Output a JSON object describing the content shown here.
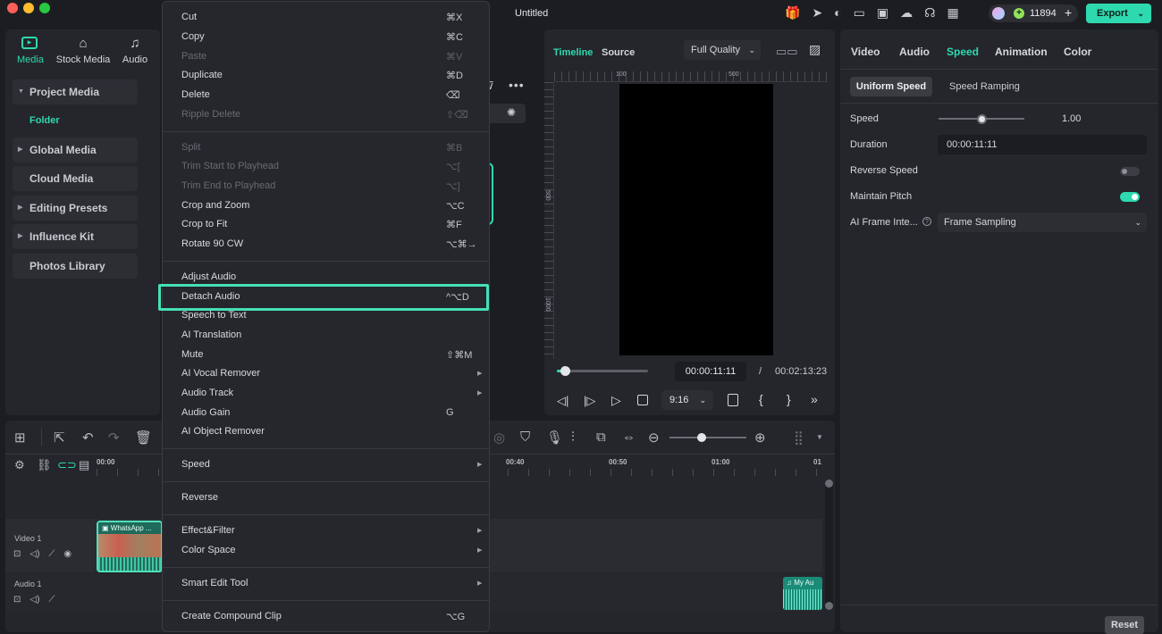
{
  "window": {
    "title": "Untitled",
    "credits": "11894",
    "export_label": "Export"
  },
  "media_tabs": [
    {
      "label": "Media"
    },
    {
      "label": "Stock Media"
    },
    {
      "label": "Audio"
    }
  ],
  "sidebar": {
    "items": [
      {
        "label": "Project Media"
      },
      {
        "label": "Folder"
      },
      {
        "label": "Global Media"
      },
      {
        "label": "Cloud Media"
      },
      {
        "label": "Editing Presets"
      },
      {
        "label": "Influence Kit"
      },
      {
        "label": "Photos Library"
      }
    ]
  },
  "context_menu": {
    "items": [
      {
        "label": "Cut",
        "shortcut": "⌘X"
      },
      {
        "label": "Copy",
        "shortcut": "⌘C"
      },
      {
        "label": "Paste",
        "shortcut": "⌘V"
      },
      {
        "label": "Duplicate",
        "shortcut": "⌘D"
      },
      {
        "label": "Delete",
        "shortcut": "⌫"
      },
      {
        "label": "Ripple Delete",
        "shortcut": "⇧⌫"
      },
      {
        "label": "Split",
        "shortcut": "⌘B"
      },
      {
        "label": "Trim Start to Playhead",
        "shortcut": "⌥["
      },
      {
        "label": "Trim End to Playhead",
        "shortcut": "⌥]"
      },
      {
        "label": "Crop and Zoom",
        "shortcut": "⌥C"
      },
      {
        "label": "Crop to Fit",
        "shortcut": "⌘F"
      },
      {
        "label": "Rotate 90 CW",
        "shortcut": "⌥⌘→"
      },
      {
        "label": "Adjust Audio",
        "shortcut": ""
      },
      {
        "label": "Detach Audio",
        "shortcut": "^⌥D"
      },
      {
        "label": "Speech to Text",
        "shortcut": ""
      },
      {
        "label": "AI Translation",
        "shortcut": ""
      },
      {
        "label": "Mute",
        "shortcut": "⇧⌘M"
      },
      {
        "label": "AI Vocal Remover",
        "shortcut": ""
      },
      {
        "label": "Audio Track",
        "shortcut": ""
      },
      {
        "label": "Audio Gain",
        "shortcut": "G"
      },
      {
        "label": "AI Object Remover",
        "shortcut": ""
      },
      {
        "label": "Speed",
        "shortcut": ""
      },
      {
        "label": "Reverse",
        "shortcut": ""
      },
      {
        "label": "Effect&Filter",
        "shortcut": ""
      },
      {
        "label": "Color Space",
        "shortcut": ""
      },
      {
        "label": "Smart Edit Tool",
        "shortcut": ""
      },
      {
        "label": "Create Compound Clip",
        "shortcut": "⌥G"
      }
    ]
  },
  "preview": {
    "tab_timeline": "Timeline",
    "tab_source": "Source",
    "quality": "Full Quality",
    "ruler_top": [
      "100",
      "500"
    ],
    "ruler_left": [
      "500",
      "1000"
    ],
    "current_time": "00:00:11:11",
    "separator": "/",
    "total_time": "00:02:13:23",
    "aspect": "9:16"
  },
  "inspector": {
    "tabs": [
      "Video",
      "Audio",
      "Speed",
      "Animation",
      "Color"
    ],
    "subtabs": [
      "Uniform Speed",
      "Speed Ramping"
    ],
    "speed_label": "Speed",
    "speed_value": "1.00",
    "duration_label": "Duration",
    "duration_value": "00:00:11:11",
    "reverse_label": "Reverse Speed",
    "pitch_label": "Maintain Pitch",
    "ai_frame_label": "AI Frame Inte...",
    "ai_frame_value": "Frame Sampling",
    "reset_label": "Reset"
  },
  "timeline": {
    "ruler": [
      "00:00",
      "00:40",
      "00:50",
      "01:00",
      "01"
    ],
    "video_track": "Video 1",
    "audio_track": "Audio 1",
    "video_clip": "WhatsApp ...",
    "audio_clip": "My Au"
  },
  "colors": {
    "accent": "#2fd9b0",
    "highlight": "#45e0b8"
  }
}
